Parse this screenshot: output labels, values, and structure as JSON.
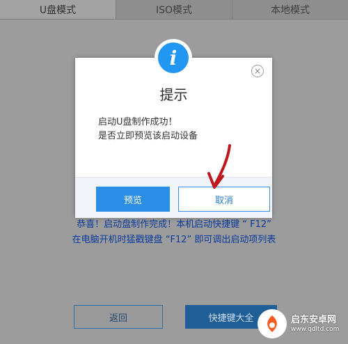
{
  "tabs": [
    {
      "label": "U盘模式"
    },
    {
      "label": "ISO模式"
    },
    {
      "label": "本地模式"
    }
  ],
  "main": {
    "message_line1": "恭喜！启动盘制作完成！本机启动快捷键 “ F12”",
    "message_line2": "在电脑开机时猛戳键盘 “F12” 即可调出启动项列表",
    "back_label": "返回",
    "shortcut_label": "快捷键大全"
  },
  "dialog": {
    "icon_glyph": "i",
    "title": "提示",
    "line1": "启动U盘制作成功！",
    "line2": "是否立即预览该启动设备",
    "preview_label": "预览",
    "cancel_label": "取消",
    "close_glyph": "×"
  },
  "watermark": {
    "brand": "启东安卓网",
    "url": "www.qdltd.com"
  },
  "colors": {
    "accent": "#2196f3",
    "primary_button": "#2a8ee6",
    "annotation_arrow": "#c0151a"
  }
}
